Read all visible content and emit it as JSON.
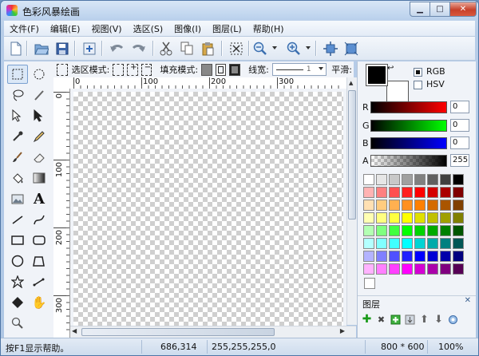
{
  "window": {
    "title": "色彩风暴绘画",
    "min_icon": "minimize-icon",
    "max_icon": "maximize-icon",
    "close_icon": "close-icon"
  },
  "menu": [
    "文件(F)",
    "编辑(E)",
    "视图(V)",
    "选区(S)",
    "图像(I)",
    "图层(L)",
    "帮助(H)"
  ],
  "toolbar": {
    "icons": [
      "new-file-icon",
      "open-folder-icon",
      "save-icon",
      "properties-icon",
      "undo-icon",
      "redo-icon",
      "cut-icon",
      "copy-icon",
      "paste-icon",
      "deselect-icon",
      "zoom-out-icon",
      "zoom-in-icon",
      "fit-window-icon",
      "actual-size-icon"
    ]
  },
  "options": {
    "select_mode_label": "选区模式:",
    "fill_mode_label": "填充模式:",
    "line_width_label": "线宽:",
    "line_width_value": "1",
    "smooth_label": "平滑:"
  },
  "tools": [
    "rect-select-icon",
    "ellipse-select-icon",
    "lasso-icon",
    "magic-wand-icon",
    "move-selection-icon",
    "move-pixels-icon",
    "color-picker-icon",
    "pencil-icon",
    "brush-icon",
    "eraser-icon",
    "paint-bucket-icon",
    "gradient-icon",
    "image-icon",
    "text-icon",
    "line-icon",
    "curve-icon",
    "rectangle-icon",
    "rounded-rect-icon",
    "ellipse-icon",
    "freeform-shape-icon",
    "star-icon",
    "arrow-line-icon",
    "clone-stamp-icon",
    "pan-hand-icon",
    "zoom-icon"
  ],
  "ruler": {
    "h": [
      "0",
      "100",
      "200",
      "300"
    ],
    "v": [
      "0",
      "100",
      "200",
      "300"
    ]
  },
  "color": {
    "primary": "#000000",
    "secondary": "#ffffff",
    "modes": [
      "RGB",
      "HSV"
    ],
    "selected_mode": "RGB",
    "channels": [
      {
        "label": "R",
        "value": "0",
        "color": "#ff0000"
      },
      {
        "label": "G",
        "value": "0",
        "color": "#00ff00"
      },
      {
        "label": "B",
        "value": "0",
        "color": "#0000ff"
      },
      {
        "label": "A",
        "value": "255",
        "color": "#000000"
      }
    ],
    "palette": [
      "#ffffff",
      "#e6e6e6",
      "#c8c8c8",
      "#a0a0a0",
      "#808080",
      "#606060",
      "#404040",
      "#000000",
      "#ffb3b3",
      "#ff8080",
      "#ff5050",
      "#ff2020",
      "#ff0000",
      "#d40000",
      "#aa0000",
      "#800000",
      "#ffe0b3",
      "#ffcc80",
      "#ffb050",
      "#ff9020",
      "#ff8000",
      "#d46a00",
      "#aa5500",
      "#804000",
      "#ffffb3",
      "#ffff80",
      "#ffff40",
      "#ffff00",
      "#e0e000",
      "#c0c000",
      "#a0a000",
      "#808000",
      "#b3ffb3",
      "#80ff80",
      "#40ff40",
      "#00ff00",
      "#00d400",
      "#00aa00",
      "#008000",
      "#005500",
      "#b3ffff",
      "#80ffff",
      "#40ffff",
      "#00ffff",
      "#00d4d4",
      "#00aaaa",
      "#008080",
      "#005555",
      "#b3b3ff",
      "#8080ff",
      "#5050ff",
      "#2020ff",
      "#0000ff",
      "#0000d4",
      "#0000aa",
      "#000080",
      "#ffb3ff",
      "#ff80ff",
      "#ff40ff",
      "#ff00ff",
      "#d400d4",
      "#aa00aa",
      "#800080",
      "#550055"
    ]
  },
  "layers": {
    "title": "图层",
    "tools": [
      "add-layer-icon",
      "delete-layer-icon",
      "duplicate-layer-icon",
      "merge-down-icon",
      "move-up-icon",
      "move-down-icon",
      "layer-properties-icon"
    ]
  },
  "status": {
    "hint": "按F1显示帮助。",
    "coords": "686,314",
    "pixel": "255,255,255,0",
    "size": "800 * 600",
    "zoom": "100%"
  }
}
